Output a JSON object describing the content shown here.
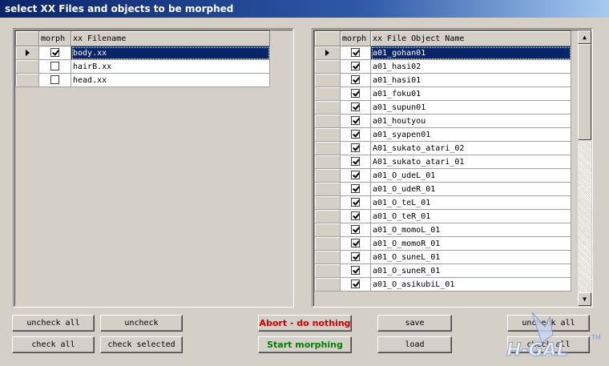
{
  "window": {
    "title": "select XX Files and objects to be morphed"
  },
  "files_grid": {
    "headers": {
      "morph": "morph",
      "name": "xx Filename"
    },
    "rows": [
      {
        "checked": true,
        "name": "body.xx",
        "selected": true
      },
      {
        "checked": false,
        "name": "hairB.xx",
        "selected": false
      },
      {
        "checked": false,
        "name": "head.xx",
        "selected": false
      }
    ]
  },
  "objects_grid": {
    "headers": {
      "morph": "morph",
      "name": "xx File Object Name"
    },
    "rows": [
      {
        "checked": true,
        "name": "a01_gohan01",
        "selected": true
      },
      {
        "checked": true,
        "name": "a01_hasi02"
      },
      {
        "checked": true,
        "name": "a01_hasi01"
      },
      {
        "checked": true,
        "name": "a01_foku01"
      },
      {
        "checked": true,
        "name": "a01_supun01"
      },
      {
        "checked": true,
        "name": "a01_houtyou"
      },
      {
        "checked": true,
        "name": "a01_syapen01"
      },
      {
        "checked": true,
        "name": "A01_sukato_atari_02"
      },
      {
        "checked": true,
        "name": "A01_sukato_atari_01"
      },
      {
        "checked": true,
        "name": "a01_O_udeL_01"
      },
      {
        "checked": true,
        "name": "a01_O_udeR_01"
      },
      {
        "checked": true,
        "name": "a01_O_teL_01"
      },
      {
        "checked": true,
        "name": "a01_O_teR_01"
      },
      {
        "checked": true,
        "name": "a01_O_momoL_01"
      },
      {
        "checked": true,
        "name": "a01_O_momoR_01"
      },
      {
        "checked": true,
        "name": "a01_O_suneL_01"
      },
      {
        "checked": true,
        "name": "a01_O_suneR_01"
      },
      {
        "checked": true,
        "name": "a01_O_asikubiL_01"
      }
    ]
  },
  "buttons": {
    "uncheck_all_left": "uncheck all",
    "uncheck": "uncheck",
    "check_all": "check all",
    "check_selected": "check selected",
    "abort": "Abort - do nothing",
    "start": "Start morphing",
    "save": "save",
    "load": "load",
    "uncheck_all_right": "uncheck all",
    "right_bottom": "check all"
  },
  "colors": {
    "title_bar": "#0a246a",
    "selection": "#0a246a",
    "abort_text": "#d00000",
    "start_text": "#008000"
  },
  "watermark": {
    "text": "H-GAL"
  }
}
